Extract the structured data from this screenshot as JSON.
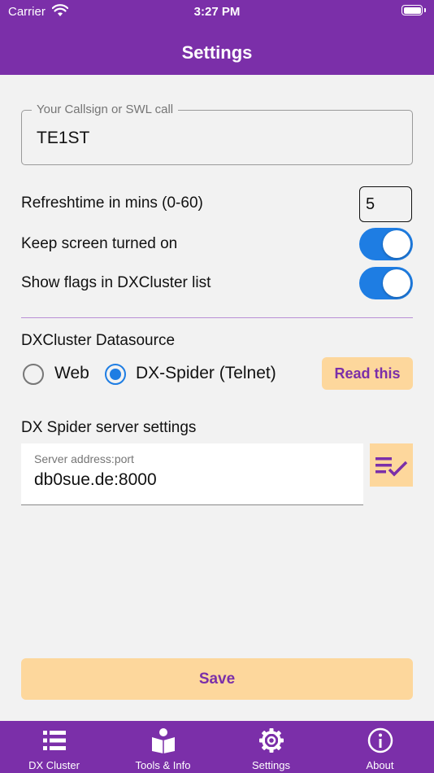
{
  "status_bar": {
    "carrier": "Carrier",
    "time": "3:27 PM",
    "wifi_icon": "wifi-icon",
    "battery_icon": "battery-icon"
  },
  "header": {
    "title": "Settings",
    "color": "#7b2fa9"
  },
  "callsign": {
    "label": "Your Callsign or SWL call",
    "value": "TE1ST"
  },
  "refresh": {
    "label": "Refreshtime in mins (0-60)",
    "value": "5"
  },
  "keep_screen_on": {
    "label": "Keep screen turned on",
    "enabled": true
  },
  "show_flags": {
    "label": "Show flags in DXCluster list",
    "enabled": true
  },
  "datasource": {
    "label": "DXCluster Datasource",
    "options": [
      {
        "label": "Web",
        "selected": false
      },
      {
        "label": "DX-Spider (Telnet)",
        "selected": true
      }
    ],
    "read_this_label": "Read this"
  },
  "dx_spider": {
    "section_label": "DX Spider server settings",
    "server_label": "Server address:port",
    "server_value": "db0sue.de:8000",
    "action_icon": "playlist-check-icon"
  },
  "save_label": "Save",
  "tabs": [
    {
      "label": "DX Cluster",
      "icon": "list-icon"
    },
    {
      "label": "Tools & Info",
      "icon": "book-reader-icon"
    },
    {
      "label": "Settings",
      "icon": "gear-icon"
    },
    {
      "label": "About",
      "icon": "info-circle-icon"
    }
  ],
  "colors": {
    "accent": "#7b2fa9",
    "toggle_on": "#1e7de3",
    "button_bg": "#fdd79c"
  }
}
